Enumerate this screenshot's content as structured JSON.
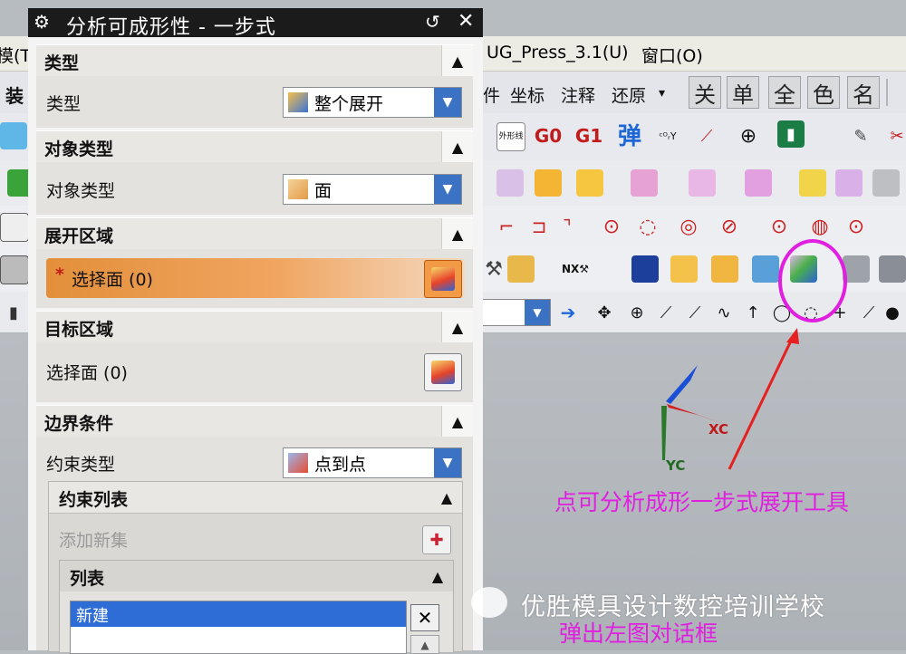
{
  "background_app": {
    "menu": [
      {
        "label": "模(T"
      },
      {
        "label": "UG_Press_3.1(U)"
      },
      {
        "label": "窗口(O)"
      }
    ],
    "toolbar_row1": {
      "left_label": "装",
      "items": [
        "件",
        "坐标",
        "注释",
        "还原"
      ],
      "square_buttons": [
        "关",
        "单",
        "全",
        "色",
        "名"
      ]
    },
    "toolbar_row2": {
      "buttons": [
        "外形线",
        "G0",
        "G1",
        "弹"
      ]
    },
    "viewport": {
      "axis_labels": [
        "XC",
        "YC"
      ]
    }
  },
  "dialog": {
    "title": "分析可成形性 - 一步式",
    "sections": [
      {
        "title": "类型",
        "row_label": "类型",
        "dropdown_value": "整个展开"
      },
      {
        "title": "对象类型",
        "row_label": "对象类型",
        "dropdown_value": "面"
      },
      {
        "title": "展开区域",
        "select_label": "选择面 (0)",
        "required_mark": "*"
      },
      {
        "title": "目标区域",
        "select_label": "选择面 (0)"
      },
      {
        "title": "边界条件",
        "row_label": "约束类型",
        "dropdown_value": "点到点"
      }
    ],
    "constraint_list": {
      "title": "约束列表",
      "add_new_set": "添加新集",
      "list_title": "列表",
      "items": [
        "新建"
      ]
    }
  },
  "annotations": {
    "callout": "点可分析成形一步式展开工具",
    "callout2": "弹出左图对话框",
    "watermark": "优胜模具设计数控培训学校",
    "highlight_color": "#e01fe0"
  }
}
